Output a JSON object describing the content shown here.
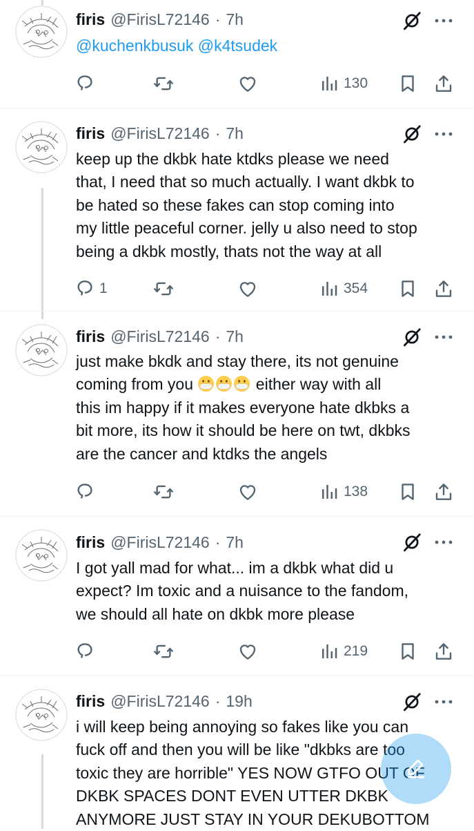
{
  "colors": {
    "accent": "#1d9bf0",
    "text": "#0f1419",
    "secondary": "#536471",
    "thread_line": "#cfd9de"
  },
  "tweets": [
    {
      "name": "firis",
      "handle": "@FirisL72146",
      "sep": "·",
      "time": "7h",
      "mentions": [
        "@kuchenkbusuk",
        "@k4tsudek"
      ],
      "reply_count": "",
      "views": "130"
    },
    {
      "name": "firis",
      "handle": "@FirisL72146",
      "sep": "·",
      "time": "7h",
      "lines": [
        "keep up the dkbk hate ktdks please we need",
        "that, I need that so much actually. I want dkbk to",
        "be hated so these fakes can stop coming into",
        "my little peaceful corner. jelly u also need to stop",
        "being a dkbk mostly, thats not the way at all"
      ],
      "reply_count": "1",
      "views": "354"
    },
    {
      "name": "firis",
      "handle": "@FirisL72146",
      "sep": "·",
      "time": "7h",
      "lines": [
        "just make bkdk and stay there, its not genuine",
        "coming from you",
        "either way with all",
        "this im happy if it makes everyone hate dkbks a",
        "bit more, its how it should be here on twt, dkbks",
        "are the cancer and ktdks the angels"
      ],
      "emojis": [
        "mask-face-emoji",
        "mask-face-emoji",
        "mask-face-emoji"
      ],
      "reply_count": "",
      "views": "138"
    },
    {
      "name": "firis",
      "handle": "@FirisL72146",
      "sep": "·",
      "time": "7h",
      "lines": [
        "I got yall mad for what... im a dkbk what did u",
        "expect? Im toxic and a nuisance to the fandom,",
        "we should all hate on dkbk more please"
      ],
      "reply_count": "",
      "views": "219"
    },
    {
      "name": "firis",
      "handle": "@FirisL72146",
      "sep": "·",
      "time": "19h",
      "lines": [
        "i will keep being annoying so fakes like you can",
        "fuck off and then you will be like \"dkbks are too",
        "toxic they are horrible\" YES NOW GTFO OUT OF",
        "DKBK SPACES DONT EVEN UTTER DKBK",
        "ANYMORE JUST STAY IN YOUR DEKUBOTTOM"
      ]
    }
  ],
  "icons": {
    "reply": "reply-icon",
    "repost": "repost-icon",
    "like": "like-icon",
    "views": "views-icon",
    "bookmark": "bookmark-icon",
    "share": "share-icon",
    "grok": "grok-icon",
    "more": "more-icon",
    "compose": "compose-icon"
  }
}
